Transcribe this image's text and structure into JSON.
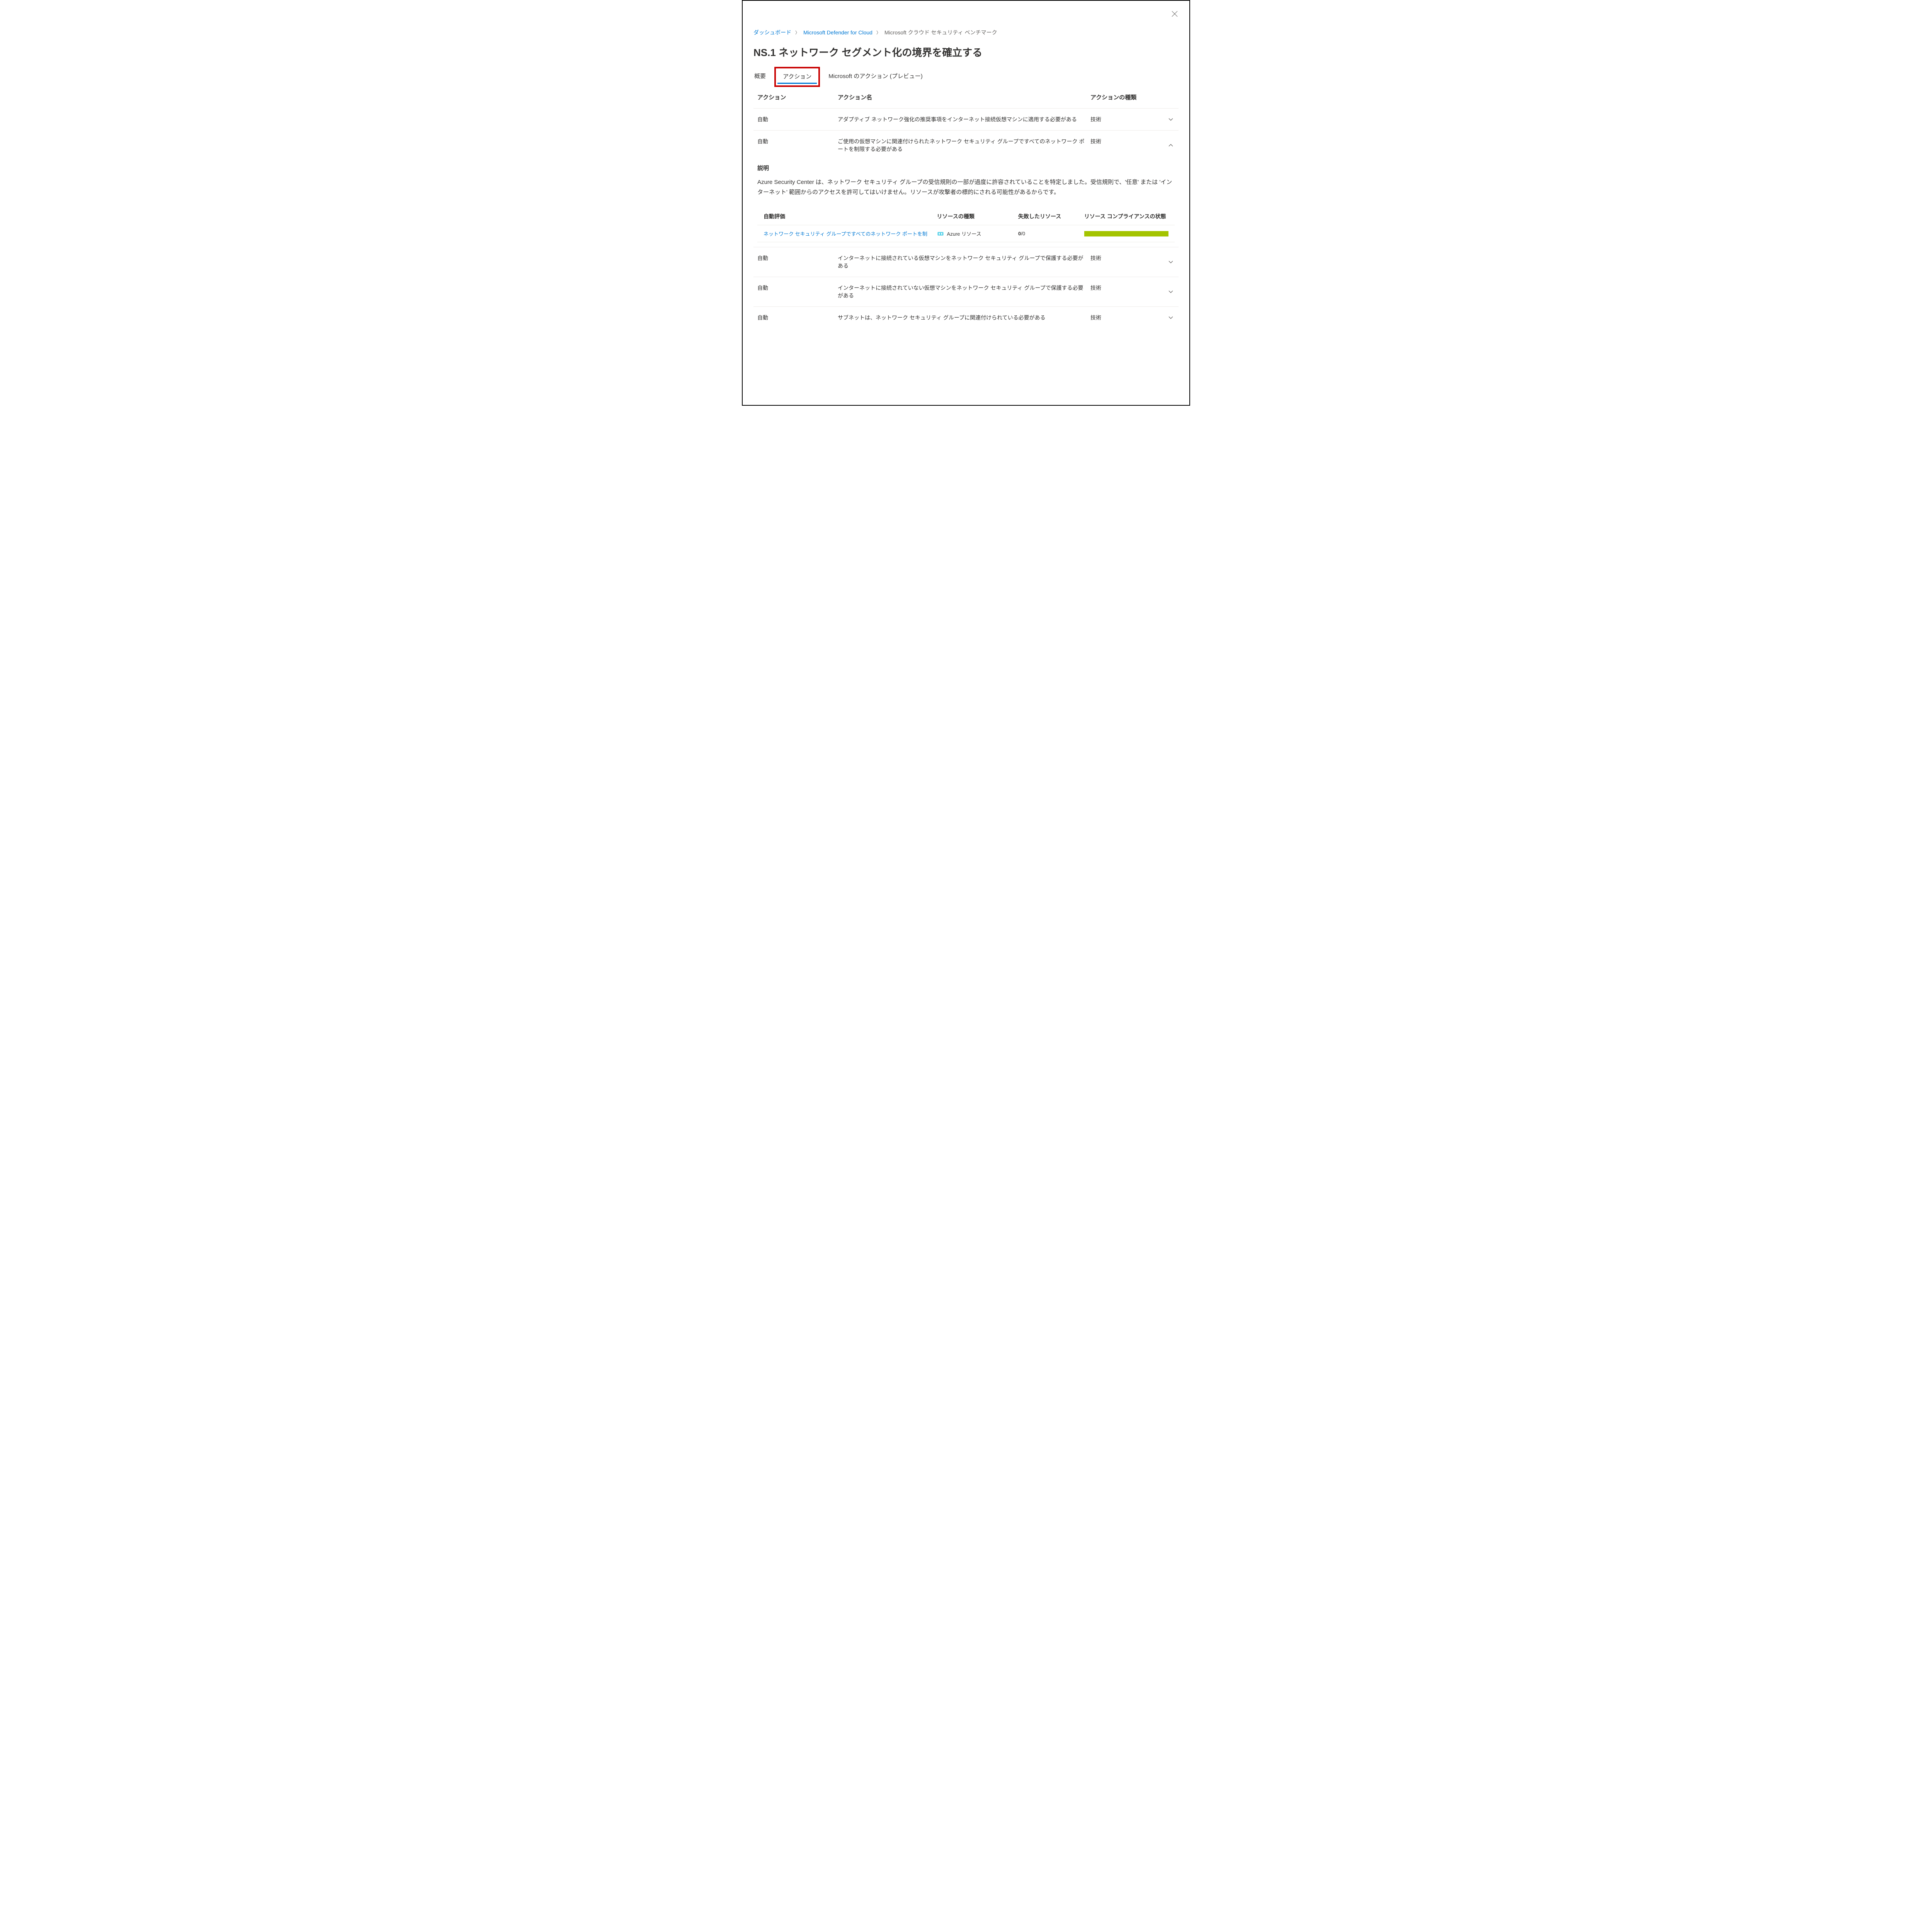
{
  "breadcrumbs": {
    "item0": "ダッシュボード",
    "item1": "Microsoft Defender for Cloud",
    "current": "Microsoft クラウド セキュリティ ベンチマーク"
  },
  "title": "NS.1 ネットワーク セグメント化の境界を確立する",
  "tabs": {
    "overview": "概要",
    "actions": "アクション",
    "ms_actions": "Microsoft のアクション (プレビュー)"
  },
  "actionHeader": {
    "col_action": "アクション",
    "col_name": "アクション名",
    "col_type": "アクションの種類"
  },
  "rows": {
    "r0": {
      "action": "自動",
      "name": "アダプティブ ネットワーク強化の推奨事項をインターネット接続仮想マシンに適用する必要がある",
      "type": "技術"
    },
    "r1": {
      "action": "自動",
      "name": "ご使用の仮想マシンに関連付けられたネットワーク セキュリティ グループですべてのネットワーク ポートを制限する必要がある",
      "type": "技術"
    },
    "r2": {
      "action": "自動",
      "name": "インターネットに接続されている仮想マシンをネットワーク セキュリティ グループで保護する必要がある",
      "type": "技術"
    },
    "r3": {
      "action": "自動",
      "name": "インターネットに接続されていない仮想マシンをネットワーク セキュリティ グループで保護する必要がある",
      "type": "技術"
    },
    "r4": {
      "action": "自動",
      "name": "サブネットは、ネットワーク セキュリティ グループに関連付けられている必要がある",
      "type": "技術"
    }
  },
  "expanded": {
    "heading": "説明",
    "description": "Azure Security Center は、ネットワーク セキュリティ グループの受信規則の一部が過度に許容されていることを特定しました。受信規則で、'任意' または 'インターネット' 範囲からのアクセスを許可してはいけません。リソースが攻撃者の標的にされる可能性があるからです。"
  },
  "assessHeader": {
    "col_assess": "自動評価",
    "col_restype": "リソースの種類",
    "col_failed": "失敗したリソース",
    "col_state": "リソース コンプライアンスの状態"
  },
  "assessRow": {
    "link": "ネットワーク セキュリティ グループですべてのネットワーク ポートを制",
    "restype": "Azure リソース",
    "failed_bold": "0",
    "failed_rest": "/0"
  }
}
